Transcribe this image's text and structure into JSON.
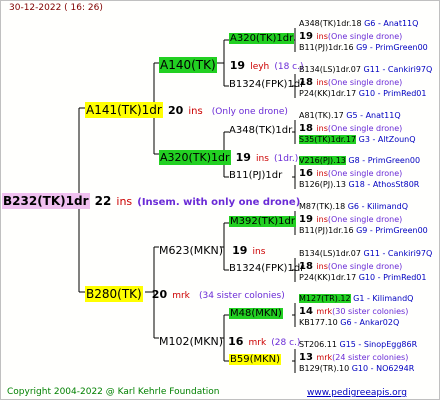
{
  "header": {
    "date": "30-12-2022 ( 16: 26)"
  },
  "footer": {
    "copyright": "Copyright 2004-2022 @ Karl Kehrle Foundation",
    "website": "www.pedigreeapis.org"
  },
  "colors": {
    "pink": "#f0c0f0",
    "yellow": "#ffff00",
    "green": "#22d022",
    "line": "#000000"
  },
  "root": {
    "name": "B232(TK)1dr",
    "count": "22",
    "unit": "ins",
    "info": "(Insem. with only one drone)"
  },
  "p1": {
    "name": "A141(TK)1dr",
    "count": "20",
    "unit": "ins",
    "info": "(Only one drone)"
  },
  "p2": {
    "name": "B280(TK)",
    "count": "20",
    "unit": "mrk",
    "info": "(34 sister colonies)"
  },
  "p11": {
    "name": "A140(TK)",
    "count": "19",
    "unit": "leyh",
    "info": "(18 c.)"
  },
  "p12": {
    "name": "A320(TK)1dr",
    "count": "19",
    "unit": "ins",
    "info": "(1dr.)"
  },
  "p21": {
    "name": "M623(MKN)",
    "count": "19",
    "unit": "ins",
    "info": ""
  },
  "p22": {
    "name": "M102(MKN)",
    "count": "16",
    "unit": "mrk",
    "info": "(28 c.)"
  },
  "g111": {
    "name": "A320(TK)1dr",
    "count": "19",
    "unit": "ins",
    "info": "(One single drone)"
  },
  "g112": {
    "name": "B1324(FPK)1dr",
    "count": "18",
    "unit": "ins",
    "info": "(One single drone)"
  },
  "g121": {
    "name": "A348(TK)1dr",
    "count": "18",
    "unit": "ins",
    "info": "(One single drone)"
  },
  "g122": {
    "name": "B11(PJ)1dr",
    "count": "16",
    "unit": "ins",
    "info": "(One single drone)"
  },
  "g211": {
    "name": "M392(TK)1dr",
    "count": "19",
    "unit": "ins",
    "info": "(One single drone)"
  },
  "g212": {
    "name": "B1324(FPK)1dr",
    "count": "18",
    "unit": "ins",
    "info": "(One single drone)"
  },
  "g221": {
    "name": "M48(MKN)",
    "count": "14",
    "unit": "mrk",
    "info": "(30 sister colonies)"
  },
  "g222": {
    "name": "B59(MKN)",
    "count": "13",
    "unit": "mrk",
    "info": "(24 sister colonies)"
  },
  "pairs": [
    {
      "a": "A348(TK)1dr.18",
      "code": "G6",
      "desc": "Anat11Q"
    },
    {
      "a": "B11(PJ)1dr.16",
      "code": "G9",
      "desc": "PrimGreen00"
    },
    {
      "a": "B134(LS)1dr.07",
      "code": "G11",
      "desc": "Cankiri97Q"
    },
    {
      "a": "P24(KK)1dr.17",
      "code": "G10",
      "desc": "PrimRed01"
    },
    {
      "a": "A81(TK).17",
      "code": "G5",
      "desc": "Anat11Q"
    },
    {
      "a": "S35(TK)1dr.17",
      "code": "G3",
      "desc": "AltZounQ"
    },
    {
      "a": "V216(PJ).13",
      "code": "G8",
      "desc": "PrimGreen00"
    },
    {
      "a": "B126(PJ).13",
      "code": "G18",
      "desc": "AthosSt80R"
    },
    {
      "a": "M87(TK).18",
      "code": "G6",
      "desc": "KilimandQ"
    },
    {
      "a": "B11(PJ)1dr.16",
      "code": "G9",
      "desc": "PrimGreen00"
    },
    {
      "a": "B134(LS)1dr.07",
      "code": "G11",
      "desc": "Cankiri97Q"
    },
    {
      "a": "P24(KK)1dr.17",
      "code": "G10",
      "desc": "PrimRed01"
    },
    {
      "a": "M127(TR).12",
      "code": "G1",
      "desc": "KilimandQ"
    },
    {
      "a": "KB177.10",
      "code": "G6",
      "desc": "Ankar02Q"
    },
    {
      "a": "ST206.11",
      "code": "G15",
      "desc": "SinopEgg86R"
    },
    {
      "a": "B129(TR).10",
      "code": "G10",
      "desc": "NO6294R"
    }
  ]
}
